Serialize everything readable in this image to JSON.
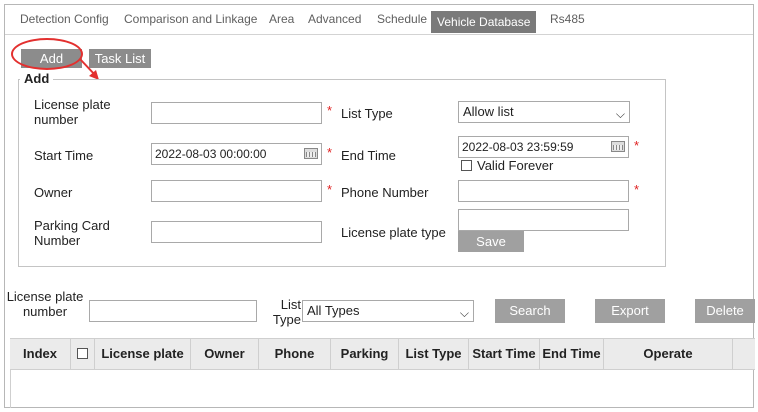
{
  "tabs": [
    {
      "label": "Detection Config"
    },
    {
      "label": "Comparison and Linkage"
    },
    {
      "label": "Area"
    },
    {
      "label": "Advanced"
    },
    {
      "label": "Schedule"
    },
    {
      "label": "Vehicle Database",
      "active": true
    },
    {
      "label": "Rs485"
    }
  ],
  "toolbar": {
    "add_label": "Add",
    "task_list_label": "Task List"
  },
  "form": {
    "legend": "Add",
    "plate_label": "License plate number",
    "plate_value": "",
    "list_type_label": "List Type",
    "list_type_value": "Allow list",
    "start_label": "Start Time",
    "start_value": "2022-08-03 00:00:00",
    "end_label": "End Time",
    "end_value": "2022-08-03 23:59:59",
    "valid_forever_label": "Valid Forever",
    "owner_label": "Owner",
    "owner_value": "",
    "phone_label": "Phone Number",
    "phone_value": "",
    "parking_label": "Parking Card Number",
    "parking_value": "",
    "plate_type_label": "License plate type",
    "plate_type_value": "",
    "save_label": "Save",
    "required_mark": "*"
  },
  "search": {
    "plate_label": "License plate number",
    "plate_value": "",
    "list_type_label": "List Type",
    "list_type_value": "All Types",
    "search_label": "Search",
    "export_label": "Export",
    "delete_label": "Delete"
  },
  "table": {
    "columns": [
      "Index",
      "",
      "License plate",
      "Owner",
      "Phone",
      "Parking",
      "List Type",
      "Start Time",
      "End Time",
      "Operate",
      ""
    ]
  },
  "colors": {
    "annotation": "#e3302f",
    "active_tab": "#7a7a7a",
    "button": "#8c8c8c"
  }
}
